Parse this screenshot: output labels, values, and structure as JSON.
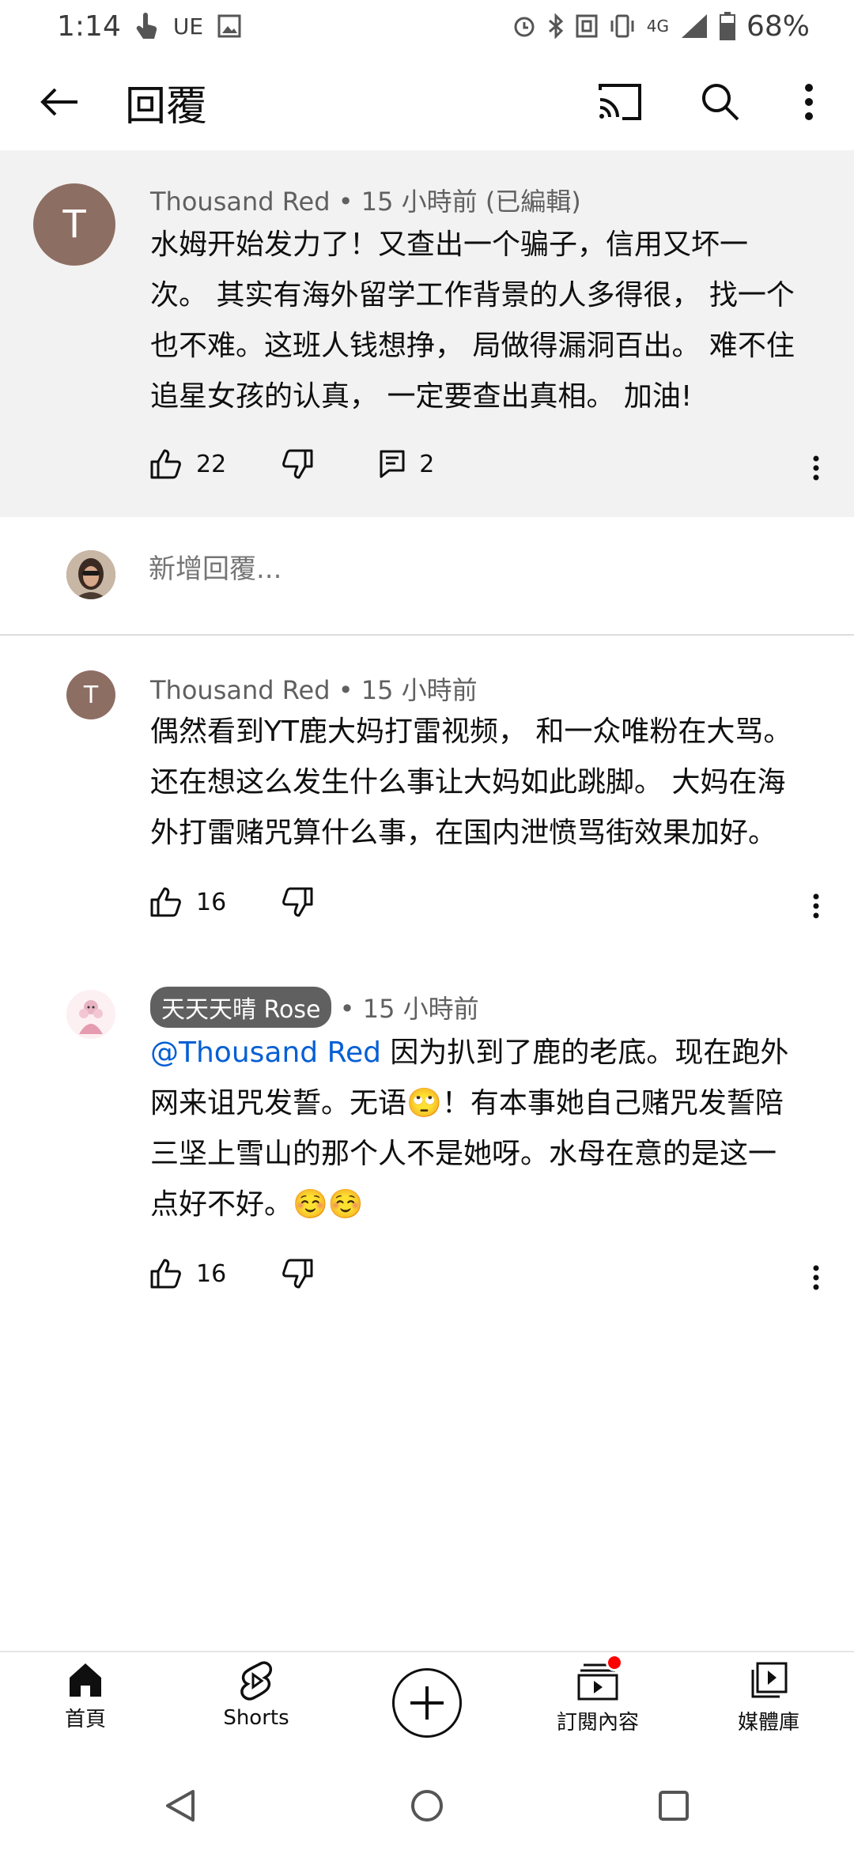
{
  "status_bar": {
    "time": "1:14",
    "carrier": "UE",
    "network": "4G",
    "battery": "68%"
  },
  "app_bar": {
    "title": "回覆"
  },
  "top_comment": {
    "avatar_letter": "T",
    "author": "Thousand Red",
    "time": "15 小時前 (已編輯)",
    "lines": [
      "水姆开始发力了！又查出一个骗子，信用又坏一",
      "次。 其实有海外留学工作背景的人多得很， 找一个",
      "也不难。这班人钱想挣， 局做得漏洞百出。 难不住",
      "追星女孩的认真， 一定要查出真相。 加油!"
    ],
    "likes": "22",
    "replies": "2"
  },
  "add_reply": {
    "placeholder": "新增回覆..."
  },
  "replies": [
    {
      "avatar_letter": "T",
      "author": "Thousand Red",
      "time": "15 小時前",
      "lines": [
        "偶然看到YT鹿大妈打雷视频， 和一众唯粉在大骂。",
        "还在想这么发生什么事让大妈如此跳脚。 大妈在海",
        "外打雷赌咒算什么事，在国内泄愤骂街效果加好。"
      ],
      "likes": "16"
    },
    {
      "author": "天天天晴 Rose",
      "time": "15 小時前",
      "mention": "@Thousand Red",
      "line1_rest": " 因为扒到了鹿的老底。现在跑外",
      "lines": [
        "网来诅咒发誓。无语🙄！有本事她自己赌咒发誓陪",
        "三坚上雪山的那个人不是她呀。水母在意的是这一",
        "点好不好。☺️☺️"
      ],
      "likes": "16"
    }
  ],
  "bottom_nav": {
    "home": "首頁",
    "shorts": "Shorts",
    "subscriptions": "訂閱內容",
    "library": "媒體庫"
  },
  "colors": {
    "highlight_bg": "#f2f2f2",
    "mention": "#065fd4",
    "notification_dot": "#ff0000",
    "avatar_t": "#8d6e63"
  }
}
